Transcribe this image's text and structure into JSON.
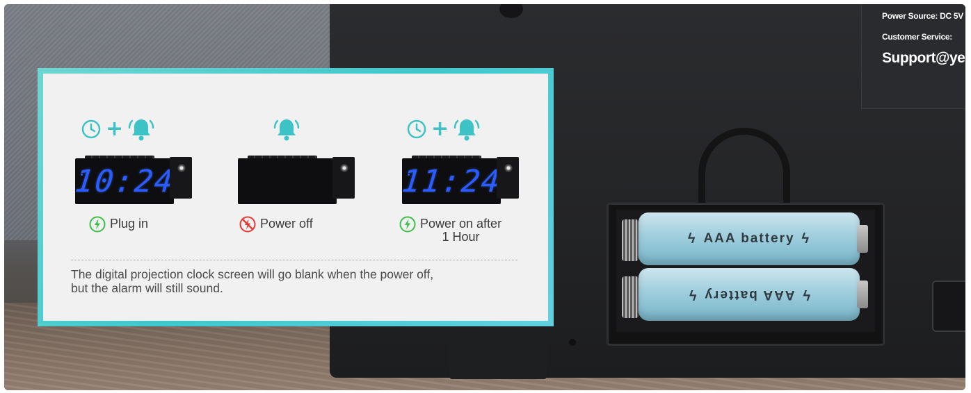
{
  "label_plate": {
    "power_source": "Power Source: DC 5V",
    "customer_service": "Customer Service:",
    "support": "Support@ye"
  },
  "batteries": {
    "top_label": "AAA battery",
    "bottom_label": "AAA battery"
  },
  "info_card": {
    "states": [
      {
        "time": "10:24",
        "status": "Plug in",
        "status_line2": "",
        "icons": [
          "clock-icon",
          "alarm-bell-icon"
        ],
        "power": "on"
      },
      {
        "time": "",
        "status": "Power off",
        "status_line2": "",
        "icons": [
          "alarm-bell-icon"
        ],
        "power": "off"
      },
      {
        "time": "11:24",
        "status": "Power on after",
        "status_line2": "1 Hour",
        "icons": [
          "clock-icon",
          "alarm-bell-icon"
        ],
        "power": "on"
      }
    ],
    "note_line1": "The digital projection clock screen will go blank when the power off,",
    "note_line2": "but the alarm will still sound."
  },
  "colors": {
    "accent_teal": "#3dc3c6",
    "digit_blue": "#2b5cff",
    "power_on_green": "#3fbf4a",
    "power_off_red": "#e53935"
  }
}
